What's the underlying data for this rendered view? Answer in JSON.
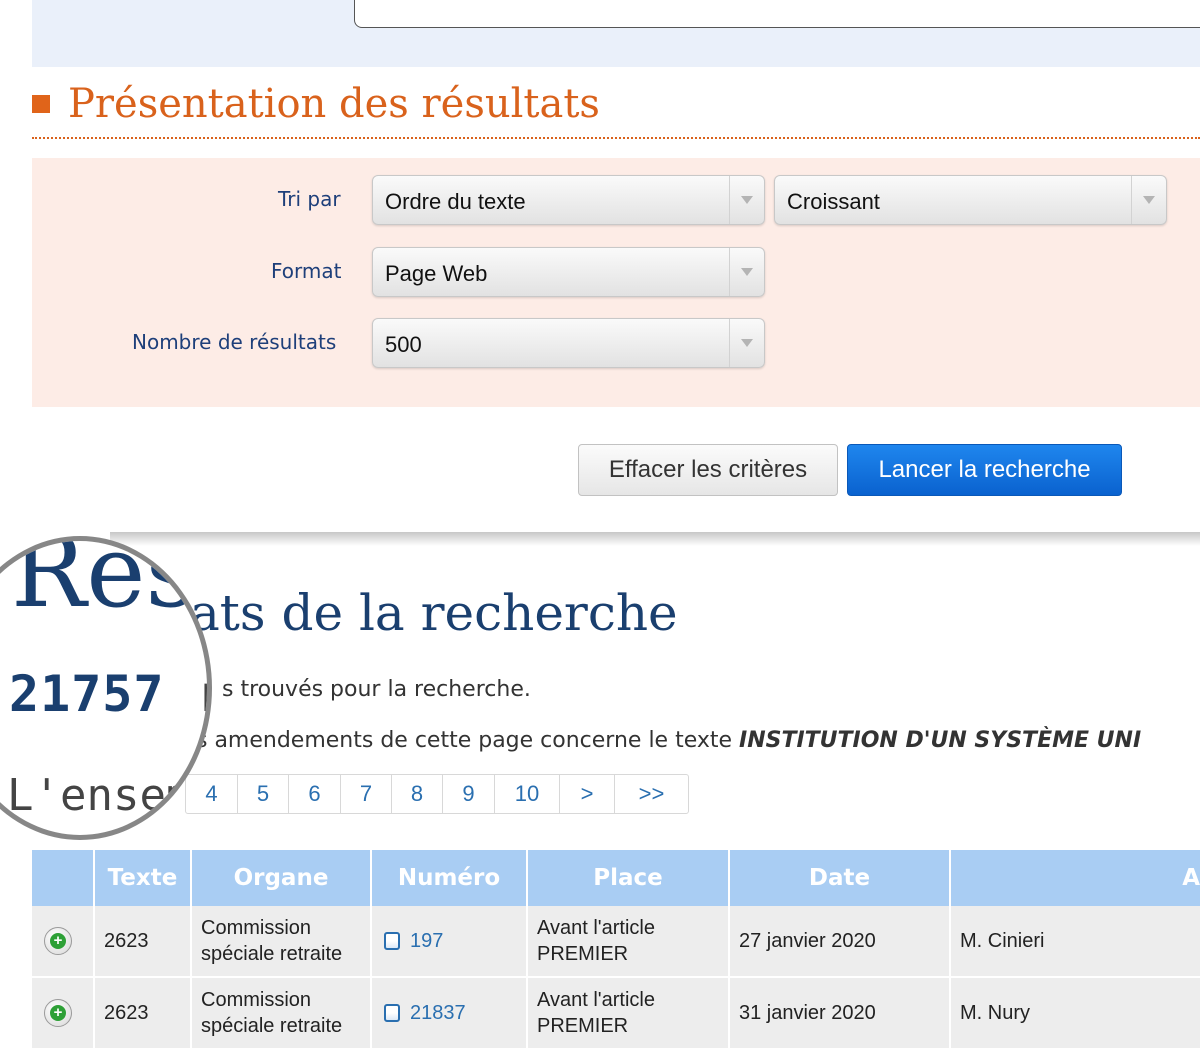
{
  "presentation": {
    "title": "Présentation des résultats",
    "sort_label": "Tri par",
    "sort_value": "Ordre du texte",
    "order_value": "Croissant",
    "format_label": "Format",
    "format_value": "Page Web",
    "count_label": "Nombre de résultats",
    "count_value": "500"
  },
  "actions": {
    "clear_label": "Effacer les critères",
    "search_label": "Lancer la recherche"
  },
  "results": {
    "title_visible": "ats de la recherche",
    "count_text": "s trouvés pour la recherche.",
    "amend_prefix": "s amendements de cette page concerne le texte ",
    "amend_text": "INSTITUTION D'UN SYSTÈME UNI"
  },
  "magnifier": {
    "res": "Rés",
    "count": "21757",
    "count_suffix": " r",
    "ens": "L'ensem"
  },
  "pager": {
    "pages": [
      "4",
      "5",
      "6",
      "7",
      "8",
      "9",
      "10",
      ">",
      ">>"
    ]
  },
  "table": {
    "headers": [
      "",
      "Texte",
      "Organe",
      "Numéro",
      "Place",
      "Date",
      "A"
    ],
    "rows": [
      {
        "texte": "2623",
        "organe": "Commission spéciale retraite",
        "numero": "197",
        "place": "Avant l'article PREMIER",
        "date": "27 janvier 2020",
        "auteur": "M. Cinieri"
      },
      {
        "texte": "2623",
        "organe": "Commission spéciale retraite",
        "numero": "21837",
        "place": "Avant l'article PREMIER",
        "date": "31 janvier 2020",
        "auteur": "M. Nury"
      }
    ]
  },
  "colors": {
    "accent_orange": "#d9621c",
    "title_blue": "#1a3f6f",
    "button_blue": "#0a62cf",
    "panel_pink": "#fdece6",
    "header_blue": "#a9cdf3"
  },
  "icons": {
    "title_marker": "orange-square-icon",
    "dropdown": "chevron-down-icon",
    "expand": "plus-circle-icon",
    "document": "document-icon"
  }
}
